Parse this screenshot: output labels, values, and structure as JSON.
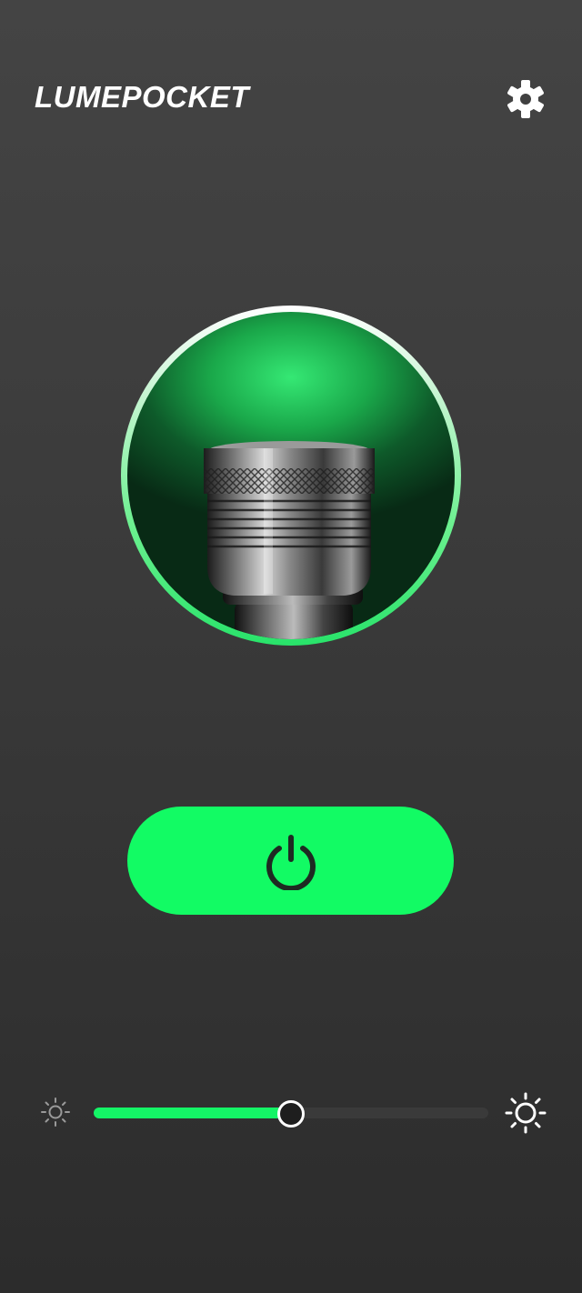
{
  "header": {
    "app_title": "LUMEPOCKET",
    "settings_icon": "gear-icon"
  },
  "lamp": {
    "image": "flashlight-head-glowing",
    "glow_color": "#2ef073",
    "ring_color": "#6bf08f"
  },
  "power": {
    "icon": "power-icon",
    "state": "on",
    "button_color": "#12fb64"
  },
  "brightness": {
    "min_icon": "sun-small-icon",
    "max_icon": "sun-large-icon",
    "value": 0.5,
    "fill_color": "#14f566"
  }
}
